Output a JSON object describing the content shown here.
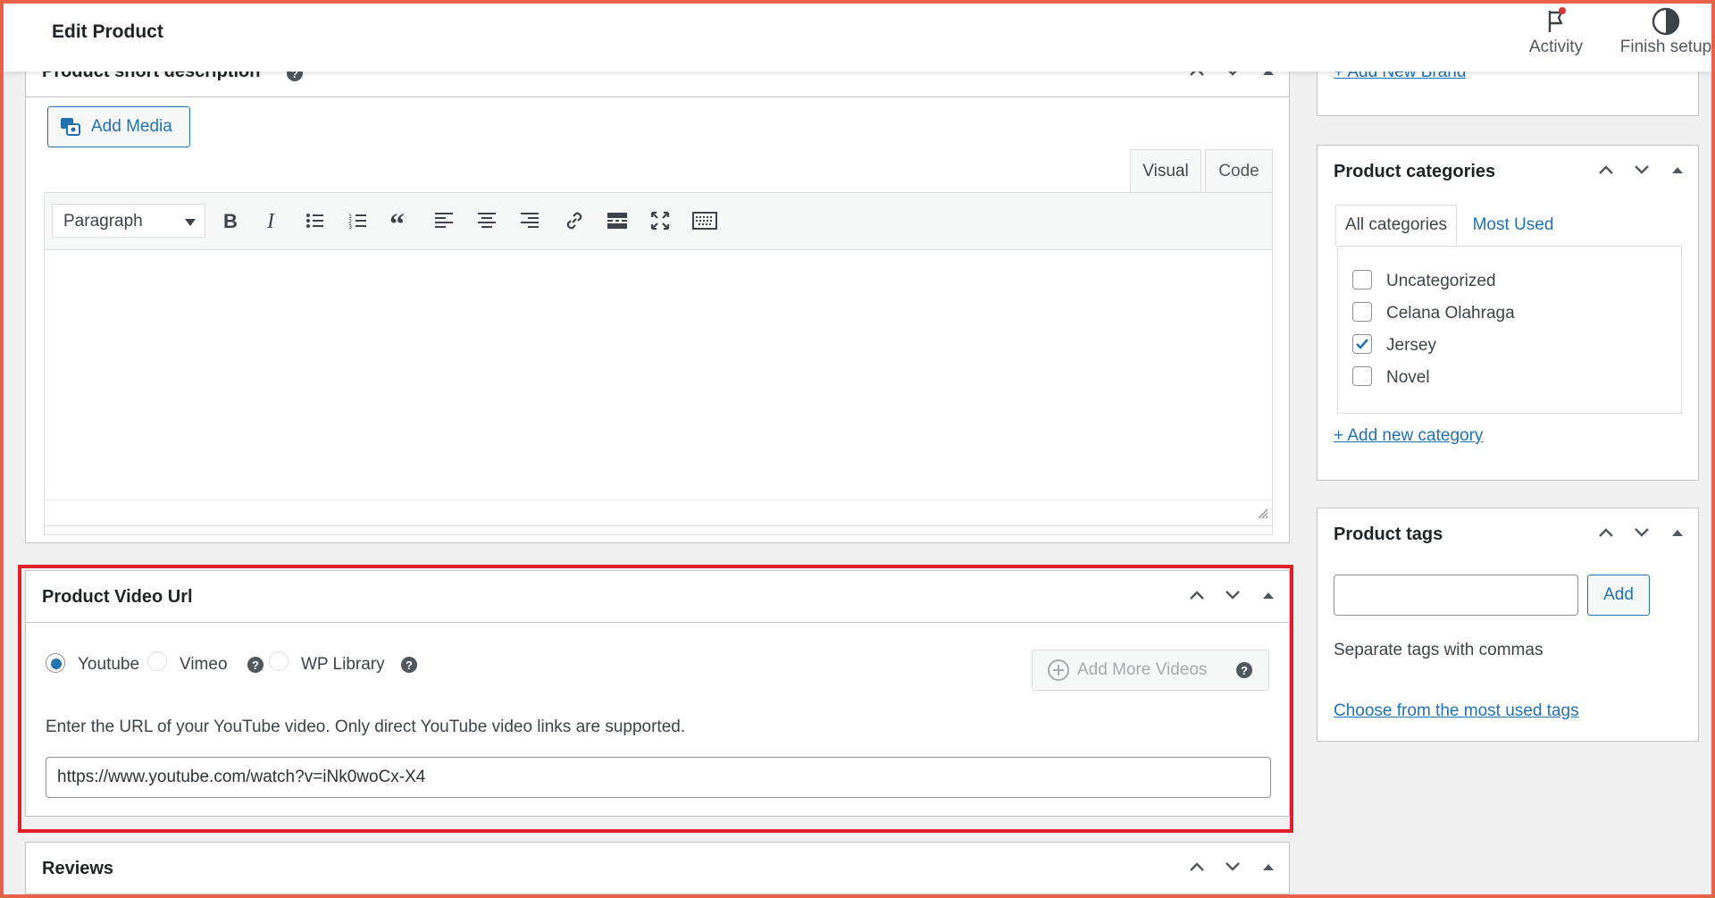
{
  "header": {
    "title": "Edit Product",
    "activity_label": "Activity",
    "finish_label": "Finish setup"
  },
  "short_description": {
    "title": "Product short description",
    "add_media": "Add Media",
    "tab_visual": "Visual",
    "tab_code": "Code",
    "format_select": "Paragraph",
    "toolbar_icons": [
      "bold-icon",
      "italic-icon",
      "bullet-list-icon",
      "numbered-list-icon",
      "blockquote-icon",
      "align-left-icon",
      "align-center-icon",
      "align-right-icon",
      "link-icon",
      "read-more-icon",
      "fullscreen-icon",
      "toolbar-toggle-icon"
    ]
  },
  "video": {
    "title": "Product Video Url",
    "options": [
      {
        "label": "Youtube",
        "selected": true
      },
      {
        "label": "Vimeo",
        "selected": false
      },
      {
        "label": "WP Library",
        "selected": false
      }
    ],
    "add_more": "Add More Videos",
    "hint": "Enter the URL of your YouTube video. Only direct YouTube video links are supported.",
    "url": "https://www.youtube.com/watch?v=iNk0woCx-X4",
    "highlight_color": "#e0212a"
  },
  "reviews": {
    "title": "Reviews"
  },
  "brand": {
    "add_new": "+ Add New Brand"
  },
  "categories": {
    "title": "Product categories",
    "tab_all": "All categories",
    "tab_most_used": "Most Used",
    "items": [
      {
        "label": "Uncategorized",
        "checked": false
      },
      {
        "label": "Celana Olahraga",
        "checked": false
      },
      {
        "label": "Jersey",
        "checked": true
      },
      {
        "label": "Novel",
        "checked": false
      }
    ],
    "add_new": "+ Add new category"
  },
  "tags": {
    "title": "Product tags",
    "input_value": "",
    "add_button": "Add",
    "hint": "Separate tags with commas",
    "choose_link": "Choose from the most used tags"
  },
  "colors": {
    "accent": "#2271b1",
    "frame": "#e8624a",
    "notify_dot": "#d63638"
  }
}
